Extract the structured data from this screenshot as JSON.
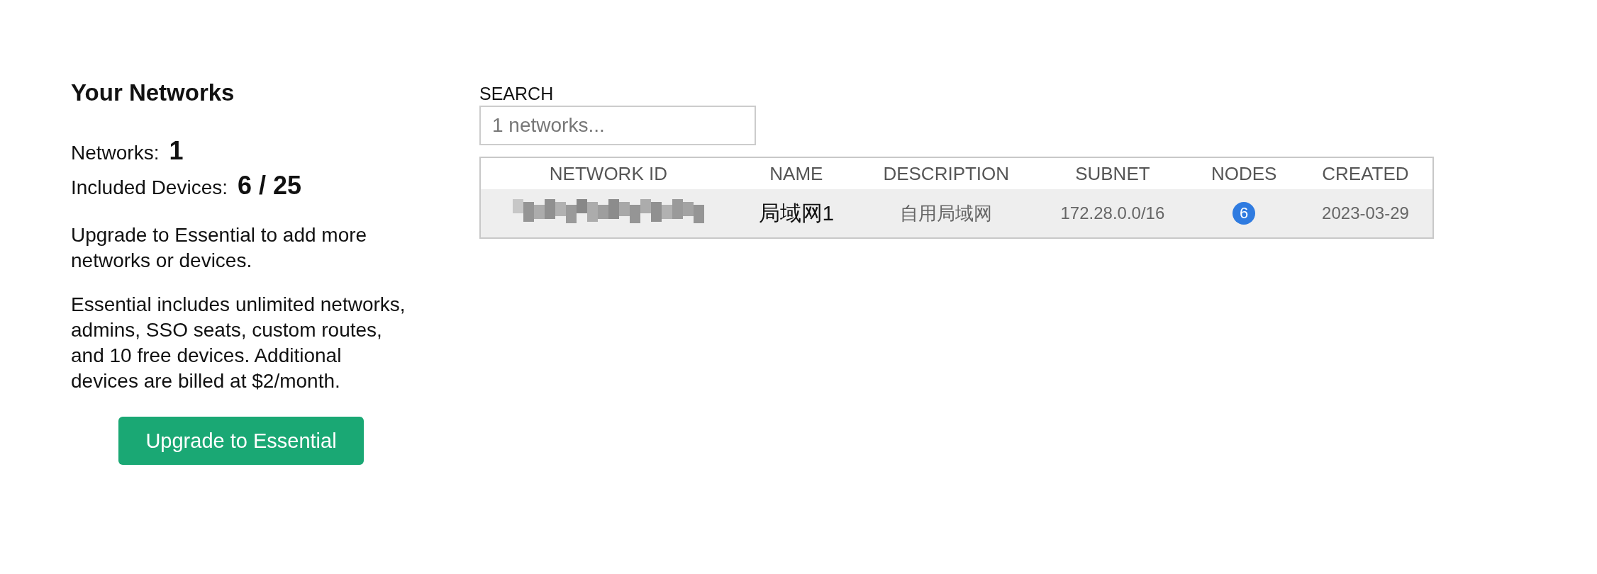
{
  "summary": {
    "title": "Your Networks",
    "stats": [
      {
        "label": "Networks:",
        "value": "1"
      },
      {
        "label": "Included Devices:",
        "value": "6 / 25"
      }
    ],
    "paragraphs": [
      "Upgrade to Essential to add more networks or devices.",
      "Essential includes unlimited networks, admins, SSO seats, custom routes, and 10 free devices. Additional devices are billed at $2/month."
    ],
    "button": "Upgrade to Essential"
  },
  "search": {
    "label": "SEARCH",
    "placeholder": "1 networks..."
  },
  "table": {
    "columns": [
      "NETWORK ID",
      "NAME",
      "DESCRIPTION",
      "SUBNET",
      "NODES",
      "CREATED"
    ],
    "rows": [
      {
        "network_id_redacted": true,
        "name": "局域网1",
        "description": "自用局域网",
        "subnet": "172.28.0.0/16",
        "nodes": "6",
        "created": "2023-03-29",
        "selected": true
      }
    ]
  }
}
